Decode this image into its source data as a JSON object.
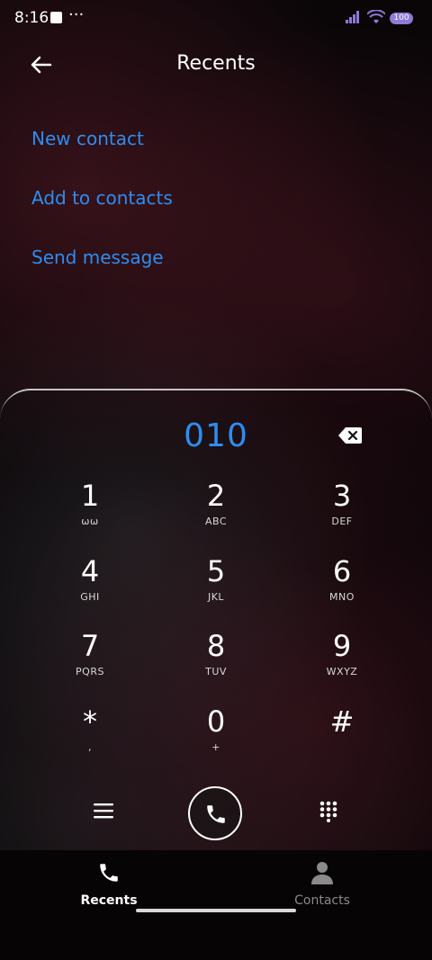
{
  "status_bar": {
    "time": "8:16",
    "overflow": "···",
    "battery": "100"
  },
  "header": {
    "title": "Recents"
  },
  "actions": [
    {
      "label": "New contact"
    },
    {
      "label": "Add to contacts"
    },
    {
      "label": "Send message"
    }
  ],
  "dialer": {
    "number": "010",
    "keys": [
      {
        "digit": "1",
        "letters": "ωω"
      },
      {
        "digit": "2",
        "letters": "ABC"
      },
      {
        "digit": "3",
        "letters": "DEF"
      },
      {
        "digit": "4",
        "letters": "GHI"
      },
      {
        "digit": "5",
        "letters": "JKL"
      },
      {
        "digit": "6",
        "letters": "MNO"
      },
      {
        "digit": "7",
        "letters": "PQRS"
      },
      {
        "digit": "8",
        "letters": "TUV"
      },
      {
        "digit": "9",
        "letters": "WXYZ"
      },
      {
        "digit": "*",
        "letters": ","
      },
      {
        "digit": "0",
        "letters": "+"
      },
      {
        "digit": "#",
        "letters": ""
      }
    ]
  },
  "tabs": [
    {
      "label": "Recents",
      "active": true
    },
    {
      "label": "Contacts",
      "active": false
    }
  ],
  "colors": {
    "accent": "#2f8cf0",
    "battery": "#8c7bd8"
  }
}
